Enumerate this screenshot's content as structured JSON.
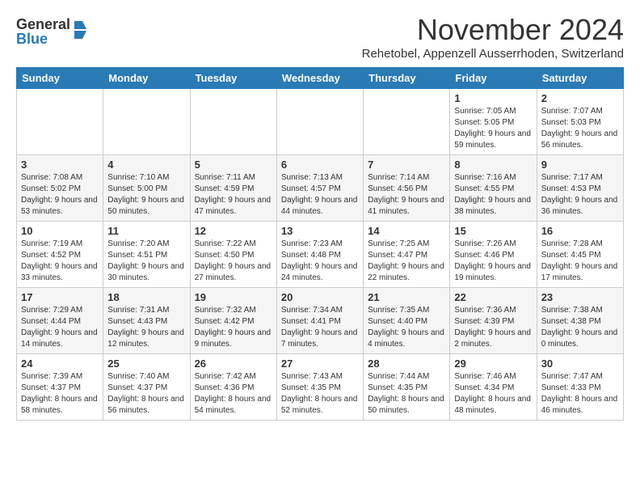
{
  "logo": {
    "line1": "General",
    "line2": "Blue"
  },
  "title": "November 2024",
  "subtitle": "Rehetobel, Appenzell Ausserrhoden, Switzerland",
  "headers": [
    "Sunday",
    "Monday",
    "Tuesday",
    "Wednesday",
    "Thursday",
    "Friday",
    "Saturday"
  ],
  "weeks": [
    [
      {
        "day": "",
        "info": ""
      },
      {
        "day": "",
        "info": ""
      },
      {
        "day": "",
        "info": ""
      },
      {
        "day": "",
        "info": ""
      },
      {
        "day": "",
        "info": ""
      },
      {
        "day": "1",
        "info": "Sunrise: 7:05 AM\nSunset: 5:05 PM\nDaylight: 9 hours and 59 minutes."
      },
      {
        "day": "2",
        "info": "Sunrise: 7:07 AM\nSunset: 5:03 PM\nDaylight: 9 hours and 56 minutes."
      }
    ],
    [
      {
        "day": "3",
        "info": "Sunrise: 7:08 AM\nSunset: 5:02 PM\nDaylight: 9 hours and 53 minutes."
      },
      {
        "day": "4",
        "info": "Sunrise: 7:10 AM\nSunset: 5:00 PM\nDaylight: 9 hours and 50 minutes."
      },
      {
        "day": "5",
        "info": "Sunrise: 7:11 AM\nSunset: 4:59 PM\nDaylight: 9 hours and 47 minutes."
      },
      {
        "day": "6",
        "info": "Sunrise: 7:13 AM\nSunset: 4:57 PM\nDaylight: 9 hours and 44 minutes."
      },
      {
        "day": "7",
        "info": "Sunrise: 7:14 AM\nSunset: 4:56 PM\nDaylight: 9 hours and 41 minutes."
      },
      {
        "day": "8",
        "info": "Sunrise: 7:16 AM\nSunset: 4:55 PM\nDaylight: 9 hours and 38 minutes."
      },
      {
        "day": "9",
        "info": "Sunrise: 7:17 AM\nSunset: 4:53 PM\nDaylight: 9 hours and 36 minutes."
      }
    ],
    [
      {
        "day": "10",
        "info": "Sunrise: 7:19 AM\nSunset: 4:52 PM\nDaylight: 9 hours and 33 minutes."
      },
      {
        "day": "11",
        "info": "Sunrise: 7:20 AM\nSunset: 4:51 PM\nDaylight: 9 hours and 30 minutes."
      },
      {
        "day": "12",
        "info": "Sunrise: 7:22 AM\nSunset: 4:50 PM\nDaylight: 9 hours and 27 minutes."
      },
      {
        "day": "13",
        "info": "Sunrise: 7:23 AM\nSunset: 4:48 PM\nDaylight: 9 hours and 24 minutes."
      },
      {
        "day": "14",
        "info": "Sunrise: 7:25 AM\nSunset: 4:47 PM\nDaylight: 9 hours and 22 minutes."
      },
      {
        "day": "15",
        "info": "Sunrise: 7:26 AM\nSunset: 4:46 PM\nDaylight: 9 hours and 19 minutes."
      },
      {
        "day": "16",
        "info": "Sunrise: 7:28 AM\nSunset: 4:45 PM\nDaylight: 9 hours and 17 minutes."
      }
    ],
    [
      {
        "day": "17",
        "info": "Sunrise: 7:29 AM\nSunset: 4:44 PM\nDaylight: 9 hours and 14 minutes."
      },
      {
        "day": "18",
        "info": "Sunrise: 7:31 AM\nSunset: 4:43 PM\nDaylight: 9 hours and 12 minutes."
      },
      {
        "day": "19",
        "info": "Sunrise: 7:32 AM\nSunset: 4:42 PM\nDaylight: 9 hours and 9 minutes."
      },
      {
        "day": "20",
        "info": "Sunrise: 7:34 AM\nSunset: 4:41 PM\nDaylight: 9 hours and 7 minutes."
      },
      {
        "day": "21",
        "info": "Sunrise: 7:35 AM\nSunset: 4:40 PM\nDaylight: 9 hours and 4 minutes."
      },
      {
        "day": "22",
        "info": "Sunrise: 7:36 AM\nSunset: 4:39 PM\nDaylight: 9 hours and 2 minutes."
      },
      {
        "day": "23",
        "info": "Sunrise: 7:38 AM\nSunset: 4:38 PM\nDaylight: 9 hours and 0 minutes."
      }
    ],
    [
      {
        "day": "24",
        "info": "Sunrise: 7:39 AM\nSunset: 4:37 PM\nDaylight: 8 hours and 58 minutes."
      },
      {
        "day": "25",
        "info": "Sunrise: 7:40 AM\nSunset: 4:37 PM\nDaylight: 8 hours and 56 minutes."
      },
      {
        "day": "26",
        "info": "Sunrise: 7:42 AM\nSunset: 4:36 PM\nDaylight: 8 hours and 54 minutes."
      },
      {
        "day": "27",
        "info": "Sunrise: 7:43 AM\nSunset: 4:35 PM\nDaylight: 8 hours and 52 minutes."
      },
      {
        "day": "28",
        "info": "Sunrise: 7:44 AM\nSunset: 4:35 PM\nDaylight: 8 hours and 50 minutes."
      },
      {
        "day": "29",
        "info": "Sunrise: 7:46 AM\nSunset: 4:34 PM\nDaylight: 8 hours and 48 minutes."
      },
      {
        "day": "30",
        "info": "Sunrise: 7:47 AM\nSunset: 4:33 PM\nDaylight: 8 hours and 46 minutes."
      }
    ]
  ]
}
